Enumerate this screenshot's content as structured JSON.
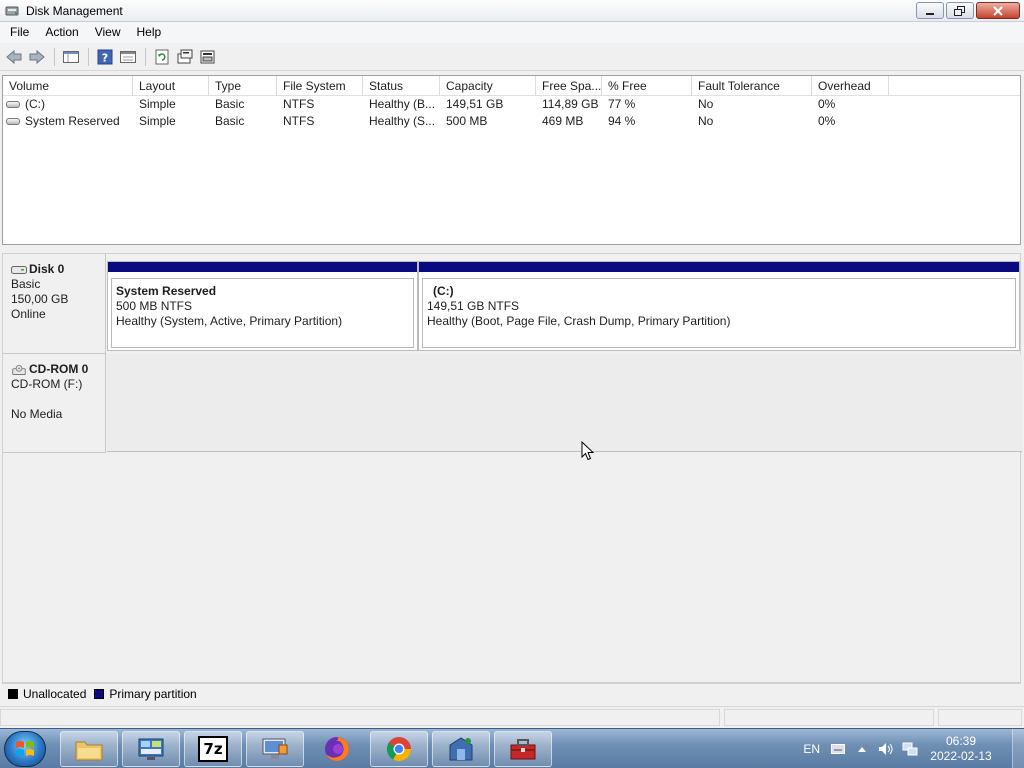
{
  "window": {
    "title": "Disk Management"
  },
  "menubar": {
    "items": [
      "File",
      "Action",
      "View",
      "Help"
    ]
  },
  "toolbar": {
    "buttons": [
      "back-icon",
      "forward-icon",
      "show-hide-console-tree-icon",
      "help-icon",
      "properties-icon",
      "refresh-icon",
      "rescan-disks-icon",
      "disk-properties-icon"
    ]
  },
  "volume_list": {
    "columns": [
      "Volume",
      "Layout",
      "Type",
      "File System",
      "Status",
      "Capacity",
      "Free Spa...",
      "% Free",
      "Fault Tolerance",
      "Overhead"
    ],
    "rows": [
      {
        "volume": "(C:)",
        "layout": "Simple",
        "type": "Basic",
        "fs": "NTFS",
        "status": "Healthy (B...",
        "capacity": "149,51 GB",
        "free": "114,89 GB",
        "pct_free": "77 %",
        "fault": "No",
        "overhead": "0%"
      },
      {
        "volume": "System Reserved",
        "layout": "Simple",
        "type": "Basic",
        "fs": "NTFS",
        "status": "Healthy (S...",
        "capacity": "500 MB",
        "free": "469 MB",
        "pct_free": "94 %",
        "fault": "No",
        "overhead": "0%"
      }
    ]
  },
  "disks": [
    {
      "name": "Disk 0",
      "type": "Basic",
      "size": "150,00 GB",
      "state": "Online",
      "partitions": [
        {
          "name": "System Reserved",
          "size_fs": "500 MB NTFS",
          "status": "Healthy (System, Active, Primary Partition)"
        },
        {
          "name": "(C:)",
          "size_fs": "149,51 GB NTFS",
          "status": "Healthy (Boot, Page File, Crash Dump, Primary Partition)"
        }
      ]
    },
    {
      "name": "CD-ROM 0",
      "type": "CD-ROM (F:)",
      "blank": "",
      "state": "No Media"
    }
  ],
  "legend": [
    {
      "label": "Unallocated",
      "color": "#000000"
    },
    {
      "label": "Primary partition",
      "color": "#0a0a80"
    }
  ],
  "taskbar": {
    "apps": [
      "explorer-icon",
      "control-panel-icon",
      "7zip-icon",
      "remote-desktop-icon",
      "firefox-icon",
      "chrome-icon",
      "network-share-icon",
      "toolbox-icon"
    ],
    "sevenzip_label": "7z",
    "language": "EN",
    "time": "06:39",
    "date": "2022-02-13"
  },
  "colors": {
    "primary_partition": "#0a0a80",
    "taskbar": "#6f8fb4"
  }
}
